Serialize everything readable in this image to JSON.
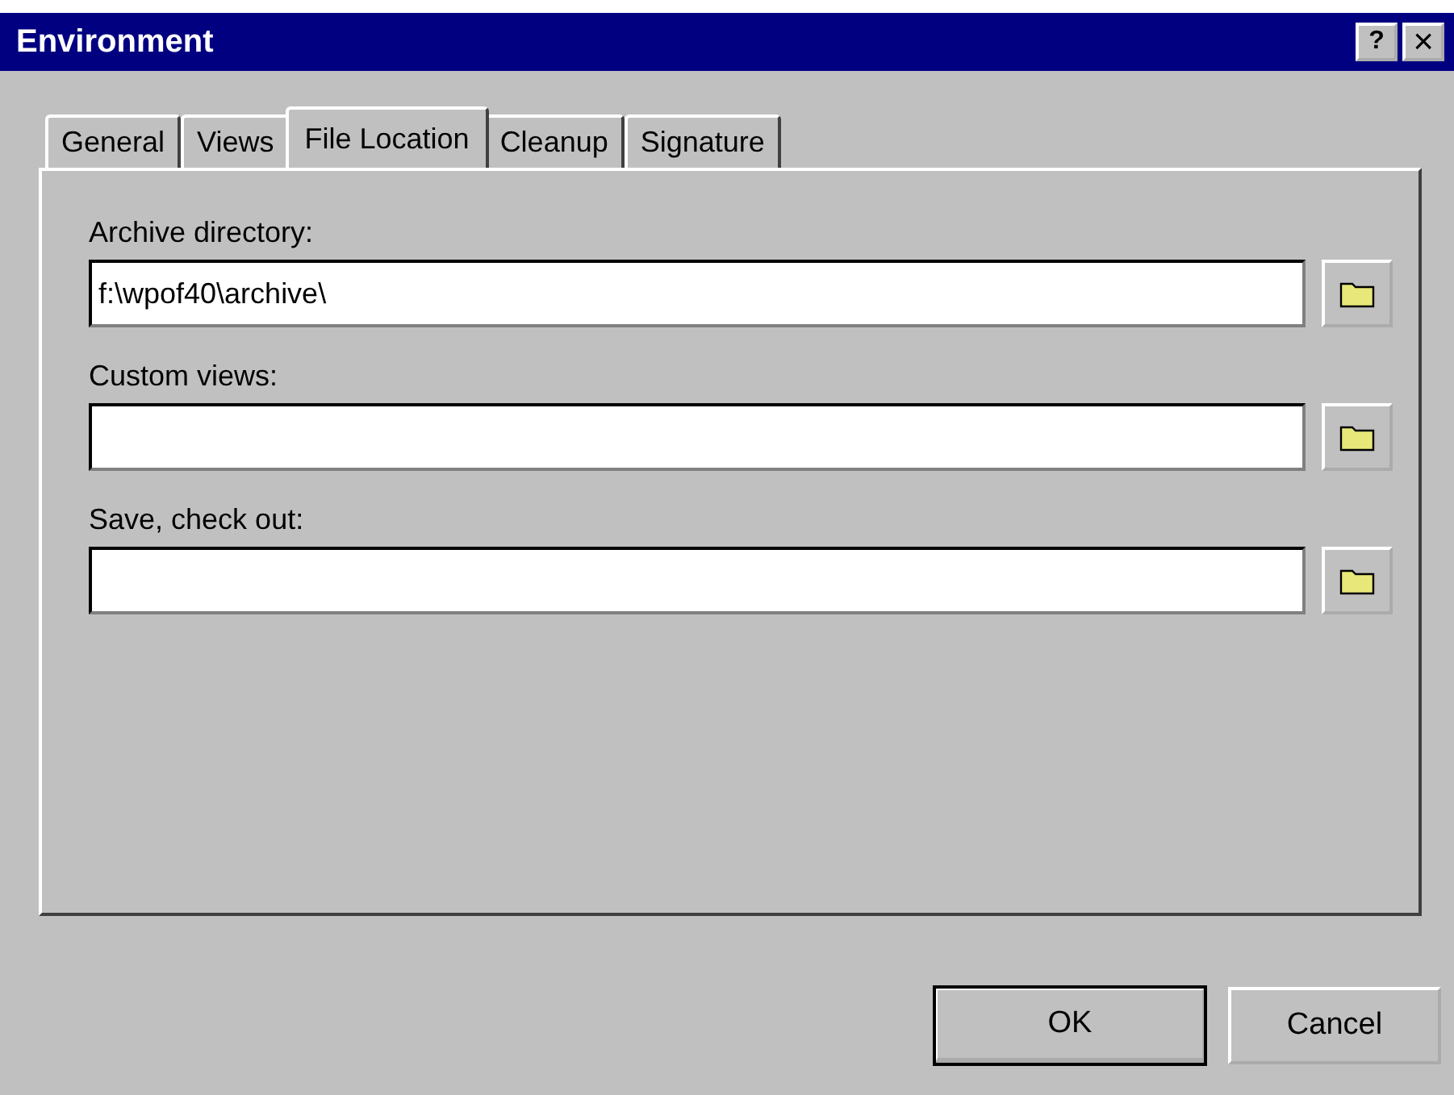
{
  "window": {
    "title": "Environment"
  },
  "title_buttons": [
    {
      "kind": "help",
      "label": "?"
    },
    {
      "kind": "close",
      "label": "×"
    }
  ],
  "tabs": [
    {
      "label": "General",
      "selected": false
    },
    {
      "label": "Views",
      "selected": false
    },
    {
      "label": "File Location",
      "selected": true
    },
    {
      "label": "Cleanup",
      "selected": false
    },
    {
      "label": "Signature",
      "selected": false
    }
  ],
  "fields": [
    {
      "label": "Archive directory:",
      "value": "f:\\wpof40\\archive\\"
    },
    {
      "label": "Custom views:"
    },
    {
      "label": "Save, check out:"
    }
  ],
  "buttons": [
    {
      "label": "OK",
      "default": true
    },
    {
      "label": "Cancel",
      "default": false
    }
  ]
}
